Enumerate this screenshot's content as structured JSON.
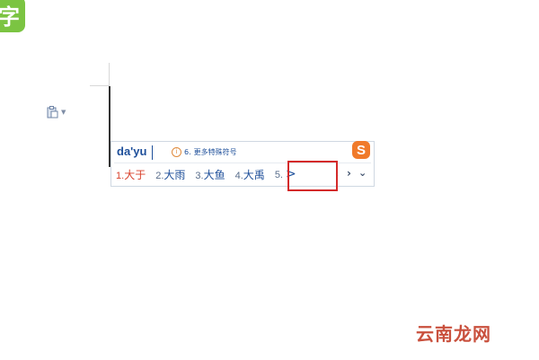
{
  "app_icon": {
    "glyph": "字"
  },
  "ime": {
    "pinyin": "da'yu",
    "hint_number": "6.",
    "hint_text": "更多特殊符号",
    "logo_letter": "S",
    "candidates": [
      {
        "num": "1.",
        "word": "大于"
      },
      {
        "num": "2.",
        "word": "大雨"
      },
      {
        "num": "3.",
        "word": "大鱼"
      },
      {
        "num": "4.",
        "word": "大禹"
      },
      {
        "num": "5.",
        "word": ">"
      }
    ],
    "prev_symbol": "‹",
    "next_symbol": "›",
    "expand_symbol": "⌄"
  },
  "watermark": "云南龙网",
  "colors": {
    "app_icon": "#7bc442",
    "sogou_logo": "#f07a2a",
    "highlight_box": "#d42a2a",
    "candidate_selected": "#d8402b",
    "candidate": "#1e4f9a"
  },
  "icons": [
    "app-icon",
    "paste-icon",
    "info-icon",
    "sogou-logo-icon",
    "prev-page-icon",
    "next-page-icon",
    "expand-icon"
  ]
}
